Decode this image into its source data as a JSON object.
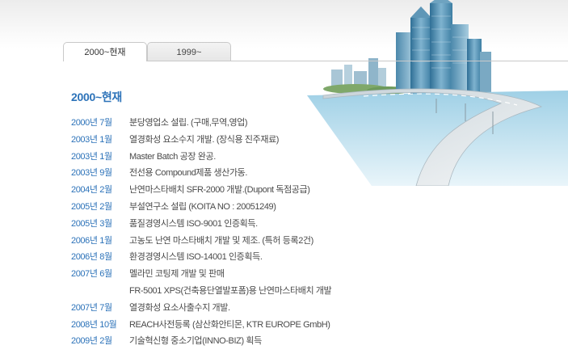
{
  "tabs": [
    {
      "label": "2000~현재",
      "active": true
    },
    {
      "label": "1999~",
      "active": false
    }
  ],
  "section_title": "2000~현재",
  "history": [
    {
      "date": "2000년 7월",
      "desc": "분당영업소 설립. (구매,무역,영업)"
    },
    {
      "date": "2003년 1월",
      "desc": "열경화성 요소수지 개발. (장식용 진주재료)"
    },
    {
      "date": "2003년 1월",
      "desc": "Master Batch 공장 완공."
    },
    {
      "date": "2003년 9월",
      "desc": "전선용 Compound제품 생산가동."
    },
    {
      "date": "2004년 2월",
      "desc": "난연마스타배치 SFR-2000 개발.(Dupont 독점공급)"
    },
    {
      "date": "2005년 2월",
      "desc": "부설연구소 설립 (KOITA NO : 20051249)"
    },
    {
      "date": "2005년 3월",
      "desc": "품질경영시스템 ISO-9001 인증획득."
    },
    {
      "date": "2006년 1월",
      "desc": "고농도 난연 마스타배치 개발 및 제조. (특허 등록2건)"
    },
    {
      "date": "2006년 8월",
      "desc": "환경경영시스템 ISO-14001 인증획득."
    },
    {
      "date": "2007년 6월",
      "desc": "멜라민 코팅제 개발 및 판매"
    },
    {
      "date": "",
      "desc": "FR-5001 XPS(건축용단열발포폼)용 난연마스타배치 개발"
    },
    {
      "date": "2007년 7월",
      "desc": "열경화성 요소사출수지 개발."
    },
    {
      "date": "2008년 10월",
      "desc": "REACH사전등록 (삼산화안티몬, KTR EUROPE GmbH)"
    },
    {
      "date": "2009년 2월",
      "desc": "기술혁신형 중소기업(INNO-BIZ) 획득"
    }
  ],
  "colors": {
    "accent": "#2d73b9",
    "text": "#4a4a4a",
    "tab_border": "#c9c9c9"
  },
  "illustration": "city-skyline-road-icon"
}
